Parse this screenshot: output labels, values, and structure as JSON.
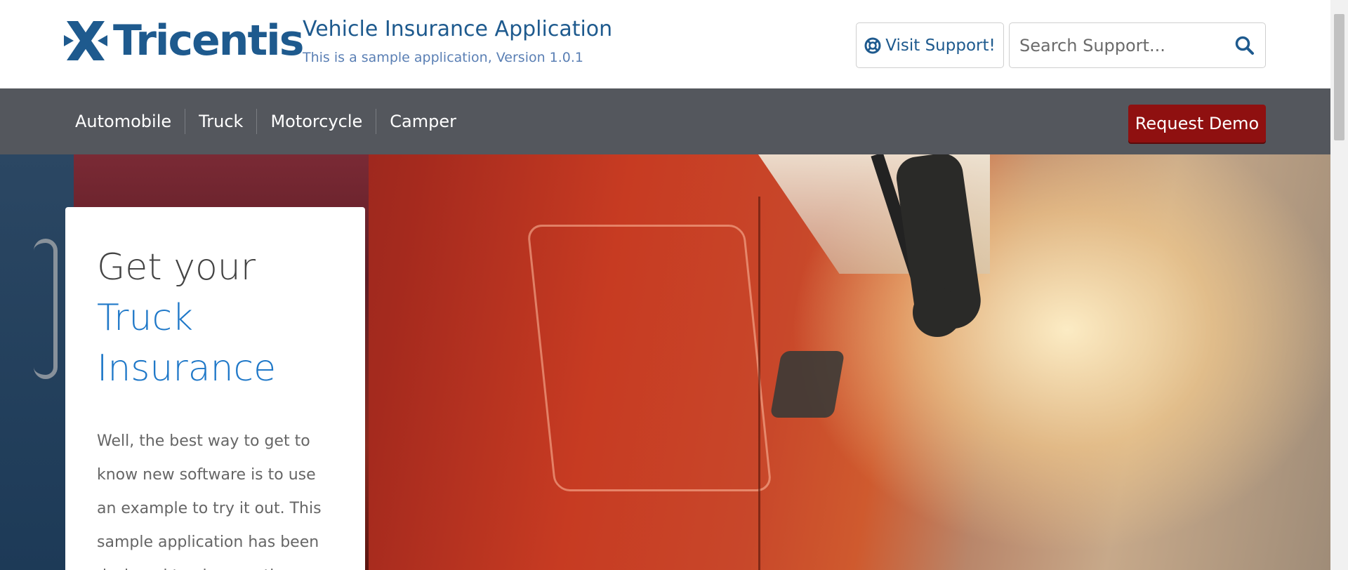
{
  "header": {
    "logo_text": "Tricentis",
    "app_title": "Vehicle Insurance Application",
    "app_subtitle": "This is a sample application, Version 1.0.1",
    "support_button_label": "Visit Support!",
    "search_placeholder": "Search Support..."
  },
  "nav": {
    "items": [
      {
        "label": "Automobile"
      },
      {
        "label": "Truck"
      },
      {
        "label": "Motorcycle"
      },
      {
        "label": "Camper"
      }
    ],
    "demo_button_label": "Request Demo"
  },
  "hero": {
    "heading_line1": "Get your",
    "heading_line2": "Truck",
    "heading_line3": "Insurance",
    "body_text": "Well, the best way to get to know new software is to use an example to try it out. This sample application has been designed to give you the"
  },
  "colors": {
    "brand_blue": "#1e5a8e",
    "accent_blue": "#1f78c8",
    "nav_bg": "#54575d",
    "demo_red": "#8f1010"
  }
}
